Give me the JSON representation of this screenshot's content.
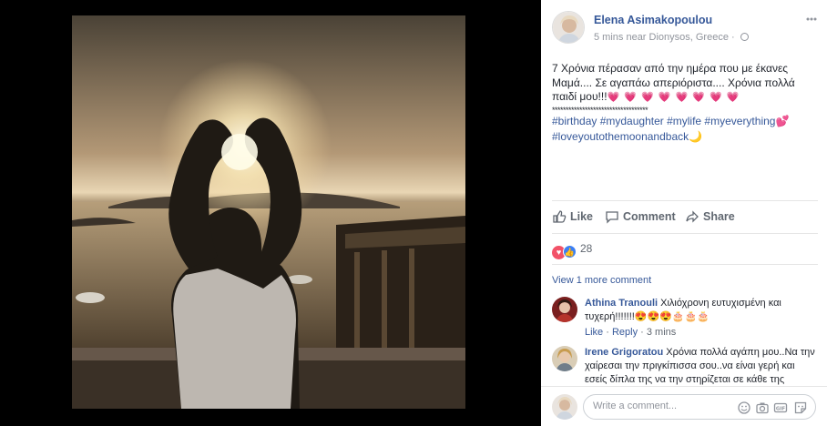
{
  "post": {
    "author": "Elena Asimakopoulou",
    "meta": "5 mins near Dionysos, Greece · ",
    "lines": [
      "7 Χρόνια πέρασαν από την ημέρα που με έκανες",
      "Μαμά.... Σε αγαπάω απεριόριστα.... Χρόνια πολλά",
      "παιδί μου!!!"
    ],
    "hearts": "💗 💗 💗 💗 💗 💗 💗 💗",
    "stars": "***********************************",
    "hashtags_line1": "#birthday #mydaughter #mylife #myeverything",
    "hashtags_line1_emoji": "💕",
    "hashtags_line2": "#loveyoutothemoonandback",
    "hashtags_line2_emoji": "🌙"
  },
  "actions": {
    "like": "Like",
    "comment": "Comment",
    "share": "Share"
  },
  "reactions": {
    "count": "28",
    "love_icon": "heart-icon",
    "like_icon": "thumbs-up-icon"
  },
  "view_more": "View 1 more comment",
  "comments": [
    {
      "name": "Athina Tranouli",
      "text": "Χιλιόχρονη ευτυχισμένη και τυχερή!!!!!!!",
      "emoji": "😍😍😍🎂🎂🎂",
      "like": "Like",
      "reply": "Reply",
      "time": "3 mins"
    },
    {
      "name": "Irene Grigoratou",
      "text": "Χρόνια πολλά αγάπη μου..Να την χαίρεσαι την πριγκίπισσα σου..να είναι γερή και εσείς δίπλα της να την στηρίζεται σε κάθε της"
    }
  ],
  "composer": {
    "placeholder": "Write a comment...",
    "icons": [
      "emoji-icon",
      "camera-icon",
      "gif-icon",
      "sticker-icon"
    ]
  },
  "colors": {
    "link": "#365899",
    "meta": "#90949c",
    "love": "#f25268",
    "like": "#3b7ff3"
  }
}
